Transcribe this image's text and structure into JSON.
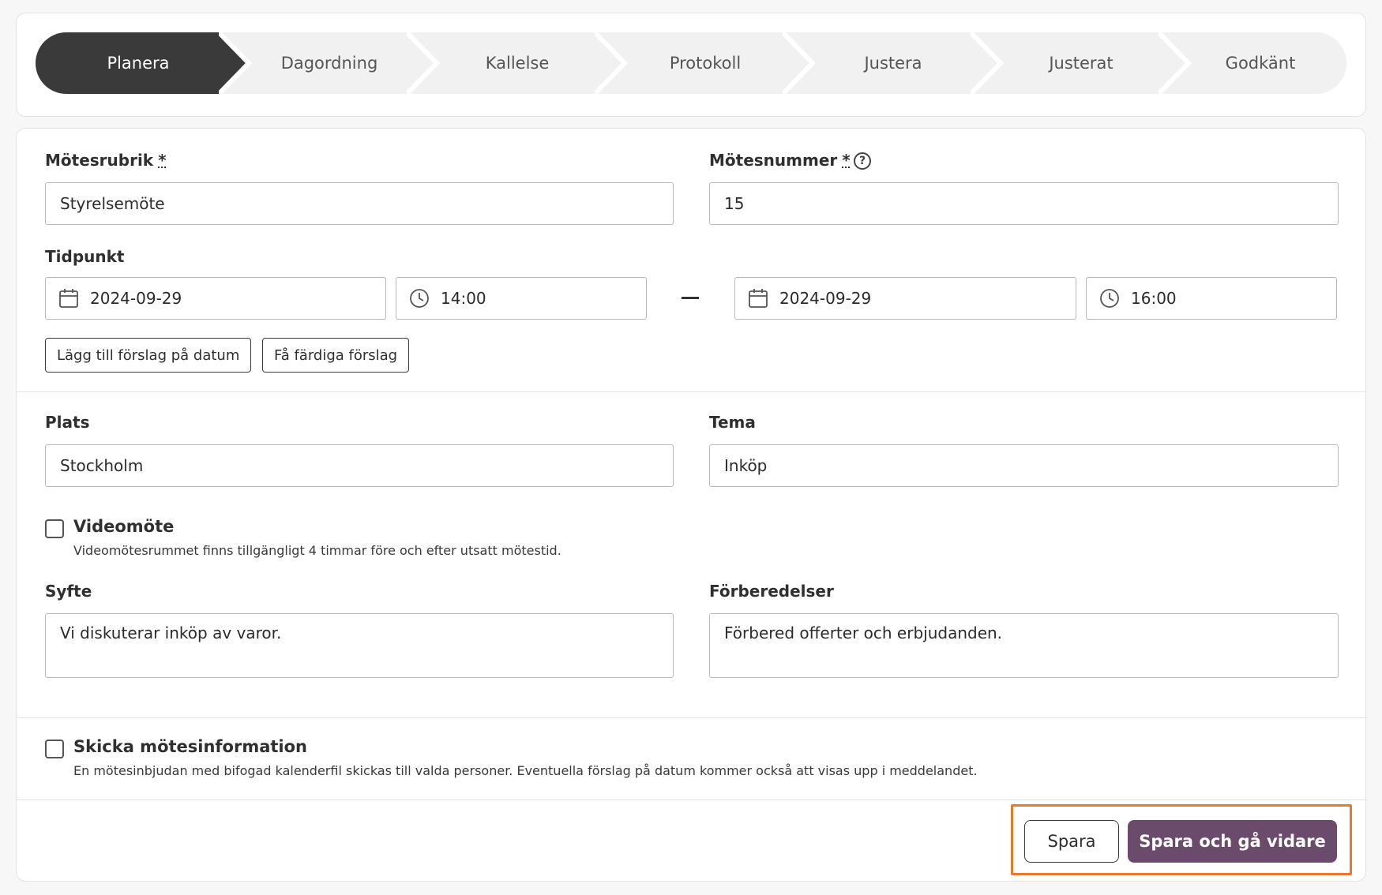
{
  "stepper": {
    "steps": [
      "Planera",
      "Dagordning",
      "Kallelse",
      "Protokoll",
      "Justera",
      "Justerat",
      "Godkänt"
    ],
    "active_index": 0
  },
  "form": {
    "title_label": "Mötesrubrik",
    "title_value": "Styrelsemöte",
    "number_label": "Mötesnummer",
    "number_value": "15",
    "required_mark": "*",
    "help_glyph": "?",
    "time_label": "Tidpunkt",
    "start_date": "2024-09-29",
    "start_time": "14:00",
    "end_date": "2024-09-29",
    "end_time": "16:00",
    "add_suggestion_button": "Lägg till förslag på datum",
    "ready_suggestions_button": "Få färdiga förslag",
    "place_label": "Plats",
    "place_value": "Stockholm",
    "theme_label": "Tema",
    "theme_value": "Inköp",
    "video_label": "Videomöte",
    "video_desc": "Videomötesrummet finns tillgängligt 4 timmar före och efter utsatt mötestid.",
    "video_checked": false,
    "purpose_label": "Syfte",
    "purpose_value": "Vi diskuterar inköp av varor.",
    "prep_label": "Förberedelser",
    "prep_value": "Förbered offerter och erbjudanden.",
    "send_label": "Skicka mötesinformation",
    "send_desc": "En mötesinbjudan med bifogad kalenderfil skickas till valda personer. Eventuella förslag på datum kommer också att visas upp i meddelandet.",
    "send_checked": false
  },
  "footer": {
    "save_button": "Spara",
    "save_continue_button": "Spara och gå vidare"
  },
  "colors": {
    "active_step": "#3a3a3a",
    "primary_button": "#6b4b6b",
    "highlight_border": "#e8782a"
  },
  "icons": {
    "date": "calendar-icon",
    "time": "clock-icon",
    "help": "help-circle-icon"
  }
}
